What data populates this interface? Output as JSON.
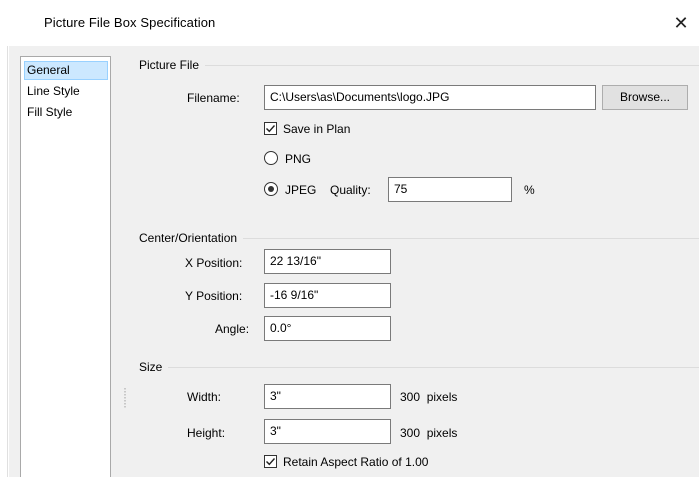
{
  "window": {
    "title": "Picture File Box Specification",
    "close_glyph": "✕"
  },
  "nav": {
    "items": [
      {
        "label": "General",
        "selected": true
      },
      {
        "label": "Line Style",
        "selected": false
      },
      {
        "label": "Fill Style",
        "selected": false
      }
    ]
  },
  "picture_file": {
    "group_label": "Picture File",
    "filename_label": "Filename:",
    "filename_value": "C:\\Users\\as\\Documents\\logo.JPG",
    "browse_label": "Browse...",
    "save_in_plan_label": "Save in Plan",
    "save_in_plan_checked": true,
    "png_label": "PNG",
    "png_selected": false,
    "jpeg_label": "JPEG",
    "jpeg_selected": true,
    "quality_label": "Quality:",
    "quality_value": "75",
    "quality_unit": "%"
  },
  "center_orientation": {
    "group_label": "Center/Orientation",
    "x_label": "X Position:",
    "x_value": "22 13/16\"",
    "y_label": "Y Position:",
    "y_value": "-16 9/16\"",
    "angle_label": "Angle:",
    "angle_value": "0.0°"
  },
  "size": {
    "group_label": "Size",
    "width_label": "Width:",
    "width_value": "3\"",
    "width_pixels": "300  pixels",
    "height_label": "Height:",
    "height_value": "3\"",
    "height_pixels": "300  pixels",
    "retain_label": "Retain Aspect Ratio of 1.00",
    "retain_checked": true
  },
  "colors": {
    "nav_selected_bg": "#cce8ff",
    "dialog_bg": "#f0f0f0"
  }
}
